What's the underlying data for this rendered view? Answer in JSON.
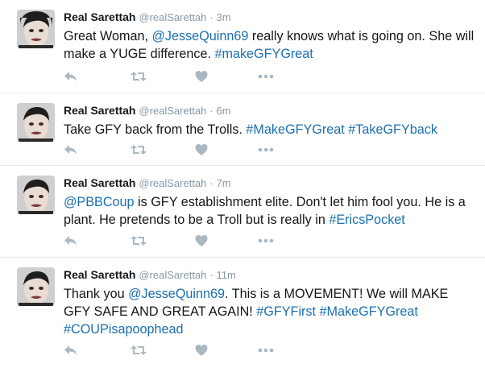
{
  "tweets": [
    {
      "name": "Real Sarettah",
      "handle": "@realSarettah",
      "separator": "·",
      "time": "3m",
      "line1": [
        {
          "t": "Great Woman, ",
          "link": false
        },
        {
          "t": "@JesseQuinn69",
          "link": true
        },
        {
          "t": " really knows what is going on. She will",
          "link": false
        }
      ],
      "line2": [
        {
          "t": "make a YUGE difference.  ",
          "link": false
        },
        {
          "t": "#makeGFYGreat",
          "link": true
        }
      ],
      "line3": []
    },
    {
      "name": "Real Sarettah",
      "handle": "@realSarettah",
      "separator": "·",
      "time": "6m",
      "line1": [
        {
          "t": "Take GFY back from the Trolls.  ",
          "link": false
        },
        {
          "t": "#MakeGFYGreat",
          "link": true
        },
        {
          "t": " ",
          "link": false
        },
        {
          "t": "#TakeGFYback",
          "link": true
        }
      ],
      "line2": [],
      "line3": []
    },
    {
      "name": "Real Sarettah",
      "handle": "@realSarettah",
      "separator": "·",
      "time": "7m",
      "line1": [
        {
          "t": "@PBBCoup",
          "link": true
        },
        {
          "t": " is GFY establishment elite.  Don't let him fool you.  He is a",
          "link": false
        }
      ],
      "line2": [
        {
          "t": "plant. He pretends to be a Troll but is really in ",
          "link": false
        },
        {
          "t": "#EricsPocket",
          "link": true
        }
      ],
      "line3": []
    },
    {
      "name": "Real Sarettah",
      "handle": "@realSarettah",
      "separator": "·",
      "time": "11m",
      "line1": [
        {
          "t": "Thank you ",
          "link": false
        },
        {
          "t": "@JesseQuinn69",
          "link": true
        },
        {
          "t": ". This is a MOVEMENT! We will MAKE",
          "link": false
        }
      ],
      "line2": [
        {
          "t": "GFY SAFE AND GREAT AGAIN! ",
          "link": false
        },
        {
          "t": "#GFYFirst",
          "link": true
        },
        {
          "t": " ",
          "link": false
        },
        {
          "t": "#MakeGFYGreat",
          "link": true
        }
      ],
      "line3": [
        {
          "t": "#COUPisapoophead",
          "link": true
        }
      ]
    }
  ],
  "actions": [
    "reply-icon",
    "retweet-icon",
    "like-icon",
    "more-icon"
  ],
  "colors": {
    "link": "#1b6fb0",
    "meta": "#8899a6",
    "icon": "#aab8c2",
    "divider": "#e6ecf0"
  }
}
